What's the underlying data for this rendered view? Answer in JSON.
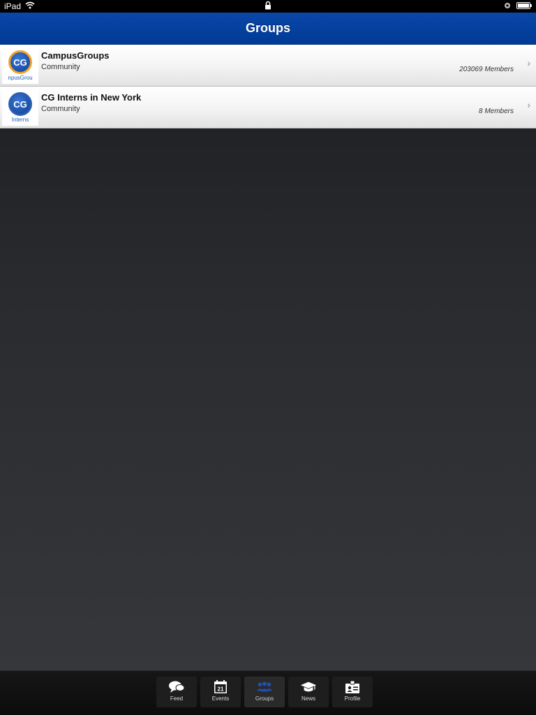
{
  "status_bar": {
    "device": "iPad"
  },
  "nav": {
    "title": "Groups"
  },
  "groups": [
    {
      "name": "CampusGroups",
      "type": "Community",
      "members": "203069 Members",
      "logo_text": "CG",
      "logo_caption": "npusGrou"
    },
    {
      "name": "CG Interns in New York",
      "type": "Community",
      "members": "8 Members",
      "logo_text": "CG",
      "logo_caption": "Interns"
    }
  ],
  "tabs": [
    {
      "label": "Feed",
      "icon": "feed-icon"
    },
    {
      "label": "Events",
      "icon": "calendar-icon",
      "icon_text": "21"
    },
    {
      "label": "Groups",
      "icon": "groups-icon",
      "active": true
    },
    {
      "label": "News",
      "icon": "graduation-cap-icon"
    },
    {
      "label": "Profile",
      "icon": "id-badge-icon"
    }
  ],
  "colors": {
    "nav_blue": "#003a96",
    "active_tab_icon": "#1f4fb4"
  }
}
